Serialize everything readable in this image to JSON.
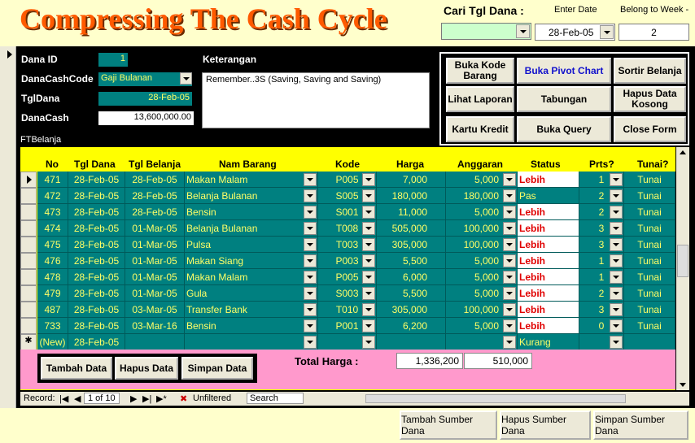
{
  "header": {
    "title": "Compressing The Cash Cycle",
    "cari_label": "Cari Tgl Dana :",
    "enter_date_label": "Enter Date",
    "belong_week_label": "Belong to Week -",
    "cari_value": "",
    "enter_date_value": "28-Feb-05",
    "week_value": "2"
  },
  "form": {
    "dana_id_label": "Dana ID",
    "dana_id_value": "1",
    "danacashcode_label": "DanaCashCode",
    "danacashcode_value": "Gaji Bulanan",
    "tgldana_label": "TglDana",
    "tgldana_value": "28-Feb-05",
    "danacash_label": "DanaCash",
    "danacash_value": "13,600,000.00",
    "keterangan_label": "Keterangan",
    "keterangan_value": "Remember..3S (Saving, Saving and Saving)",
    "ftbelanja_label": "FTBelanja"
  },
  "buttons": {
    "buka_kode_barang": "Buka Kode Barang",
    "buka_pivot_chart": "Buka Pivot Chart",
    "sortir_belanja": "Sortir Belanja",
    "lihat_laporan": "Lihat Laporan",
    "tabungan": "Tabungan",
    "hapus_data_kosong": "Hapus Data Kosong",
    "kartu_kredit": "Kartu Kredit",
    "buka_query": "Buka Query",
    "close_form": "Close Form"
  },
  "grid": {
    "headers": [
      "No",
      "Tgl Dana",
      "Tgl Belanja",
      "Nam Barang",
      "Kode",
      "Harga",
      "Anggaran",
      "Status",
      "Prts?",
      "Tunai?"
    ],
    "rows": [
      {
        "no": "471",
        "tgl_dana": "28-Feb-05",
        "tgl_belanja": "28-Feb-05",
        "nama": "Makan Malam",
        "kode": "P005",
        "harga": "7,000",
        "anggaran": "5,000",
        "status": "Lebih",
        "prts": "1",
        "tunai": "Tunai"
      },
      {
        "no": "472",
        "tgl_dana": "28-Feb-05",
        "tgl_belanja": "28-Feb-05",
        "nama": "Belanja Bulanan",
        "kode": "S005",
        "harga": "180,000",
        "anggaran": "180,000",
        "status": "Pas",
        "prts": "2",
        "tunai": "Tunai"
      },
      {
        "no": "473",
        "tgl_dana": "28-Feb-05",
        "tgl_belanja": "28-Feb-05",
        "nama": "Bensin",
        "kode": "S001",
        "harga": "11,000",
        "anggaran": "5,000",
        "status": "Lebih",
        "prts": "2",
        "tunai": "Tunai"
      },
      {
        "no": "474",
        "tgl_dana": "28-Feb-05",
        "tgl_belanja": "01-Mar-05",
        "nama": "Belanja Bulanan",
        "kode": "T008",
        "harga": "505,000",
        "anggaran": "100,000",
        "status": "Lebih",
        "prts": "3",
        "tunai": "Tunai"
      },
      {
        "no": "475",
        "tgl_dana": "28-Feb-05",
        "tgl_belanja": "01-Mar-05",
        "nama": "Pulsa",
        "kode": "T003",
        "harga": "305,000",
        "anggaran": "100,000",
        "status": "Lebih",
        "prts": "3",
        "tunai": "Tunai"
      },
      {
        "no": "476",
        "tgl_dana": "28-Feb-05",
        "tgl_belanja": "01-Mar-05",
        "nama": "Makan Siang",
        "kode": "P003",
        "harga": "5,500",
        "anggaran": "5,000",
        "status": "Lebih",
        "prts": "1",
        "tunai": "Tunai"
      },
      {
        "no": "478",
        "tgl_dana": "28-Feb-05",
        "tgl_belanja": "01-Mar-05",
        "nama": "Makan Malam",
        "kode": "P005",
        "harga": "6,000",
        "anggaran": "5,000",
        "status": "Lebih",
        "prts": "1",
        "tunai": "Tunai"
      },
      {
        "no": "479",
        "tgl_dana": "28-Feb-05",
        "tgl_belanja": "01-Mar-05",
        "nama": "Gula",
        "kode": "S003",
        "harga": "5,500",
        "anggaran": "5,000",
        "status": "Lebih",
        "prts": "2",
        "tunai": "Tunai"
      },
      {
        "no": "487",
        "tgl_dana": "28-Feb-05",
        "tgl_belanja": "03-Mar-05",
        "nama": "Transfer Bank",
        "kode": "T010",
        "harga": "305,000",
        "anggaran": "100,000",
        "status": "Lebih",
        "prts": "3",
        "tunai": "Tunai"
      },
      {
        "no": "733",
        "tgl_dana": "28-Feb-05",
        "tgl_belanja": "03-Mar-16",
        "nama": "Bensin",
        "kode": "P001",
        "harga": "6,200",
        "anggaran": "5,000",
        "status": "Lebih",
        "prts": "0",
        "tunai": "Tunai"
      }
    ],
    "new_row": {
      "no": "(New)",
      "tgl_dana": "28-Feb-05",
      "status": "Kurang"
    }
  },
  "footer": {
    "tambah_data": "Tambah Data",
    "hapus_data": "Hapus Data",
    "simpan_data": "Simpan Data",
    "total_label": "Total Harga :",
    "total_harga": "1,336,200",
    "total_anggaran": "510,000"
  },
  "nav": {
    "record_label": "Record:",
    "record_value": "1 of 10",
    "unfiltered": "Unfiltered",
    "search": "Search"
  },
  "bottom": {
    "tambah_sumber": "Tambah Sumber Dana",
    "hapus_sumber": "Hapus Sumber Dana",
    "simpan_sumber": "Simpan Sumber Dana"
  }
}
